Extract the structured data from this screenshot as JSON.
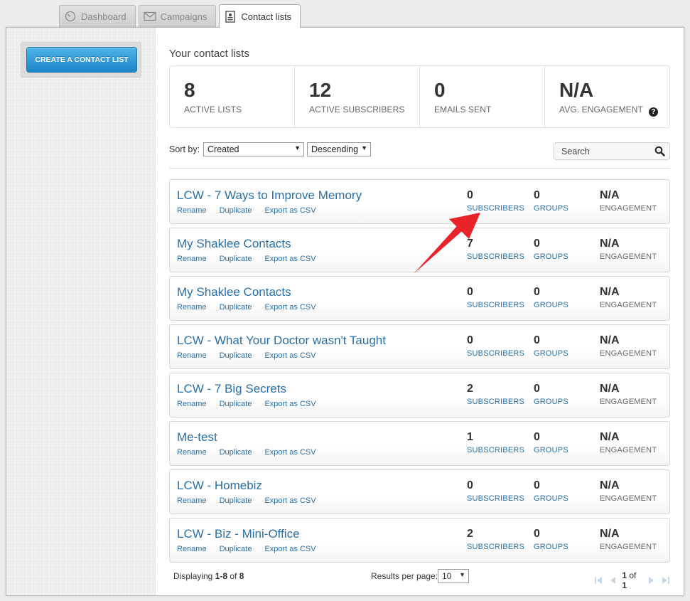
{
  "tabs": [
    {
      "label": "Dashboard",
      "icon": "gauge-icon"
    },
    {
      "label": "Campaigns",
      "icon": "envelope-icon"
    },
    {
      "label": "Contact lists",
      "icon": "contact-list-icon"
    }
  ],
  "sidebar": {
    "create_label": "CREATE A CONTACT LIST"
  },
  "page_title": "Your contact lists",
  "stats": [
    {
      "value": "8",
      "label": "ACTIVE LISTS"
    },
    {
      "value": "12",
      "label": "ACTIVE SUBSCRIBERS"
    },
    {
      "value": "0",
      "label": "EMAILS SENT"
    },
    {
      "value": "N/A",
      "label": "AVG. ENGAGEMENT",
      "help": "?"
    }
  ],
  "sort": {
    "label": "Sort by:",
    "field": "Created",
    "order": "Descending"
  },
  "search": {
    "placeholder": "Search"
  },
  "actions": {
    "rename": "Rename",
    "duplicate": "Duplicate",
    "export": "Export as CSV"
  },
  "metric_labels": {
    "subscribers": "SUBSCRIBERS",
    "groups": "GROUPS",
    "engagement": "ENGAGEMENT"
  },
  "lists": [
    {
      "name": "LCW - 7 Ways to Improve Memory",
      "subscribers": "0",
      "groups": "0",
      "engagement": "N/A"
    },
    {
      "name": "My Shaklee Contacts",
      "subscribers": "7",
      "groups": "0",
      "engagement": "N/A"
    },
    {
      "name": "My Shaklee Contacts",
      "subscribers": "0",
      "groups": "0",
      "engagement": "N/A"
    },
    {
      "name": "LCW - What Your Doctor wasn't Taught",
      "subscribers": "0",
      "groups": "0",
      "engagement": "N/A"
    },
    {
      "name": "LCW - 7 Big Secrets",
      "subscribers": "2",
      "groups": "0",
      "engagement": "N/A"
    },
    {
      "name": "Me-test",
      "subscribers": "1",
      "groups": "0",
      "engagement": "N/A"
    },
    {
      "name": "LCW - Homebiz",
      "subscribers": "0",
      "groups": "0",
      "engagement": "N/A"
    },
    {
      "name": "LCW - Biz - Mini-Office",
      "subscribers": "2",
      "groups": "0",
      "engagement": "N/A"
    }
  ],
  "footer": {
    "displaying_prefix": "Displaying ",
    "displaying_range": "1-8",
    "displaying_of": " of ",
    "displaying_total": "8",
    "results_per_page_label": "Results per page:",
    "results_per_page": "10",
    "current_page": "1",
    "page_of": " of ",
    "total_pages": "1"
  },
  "colors": {
    "link": "#2a6fa8",
    "button": "#2a9ad9",
    "annotation_arrow": "#e8232a"
  }
}
